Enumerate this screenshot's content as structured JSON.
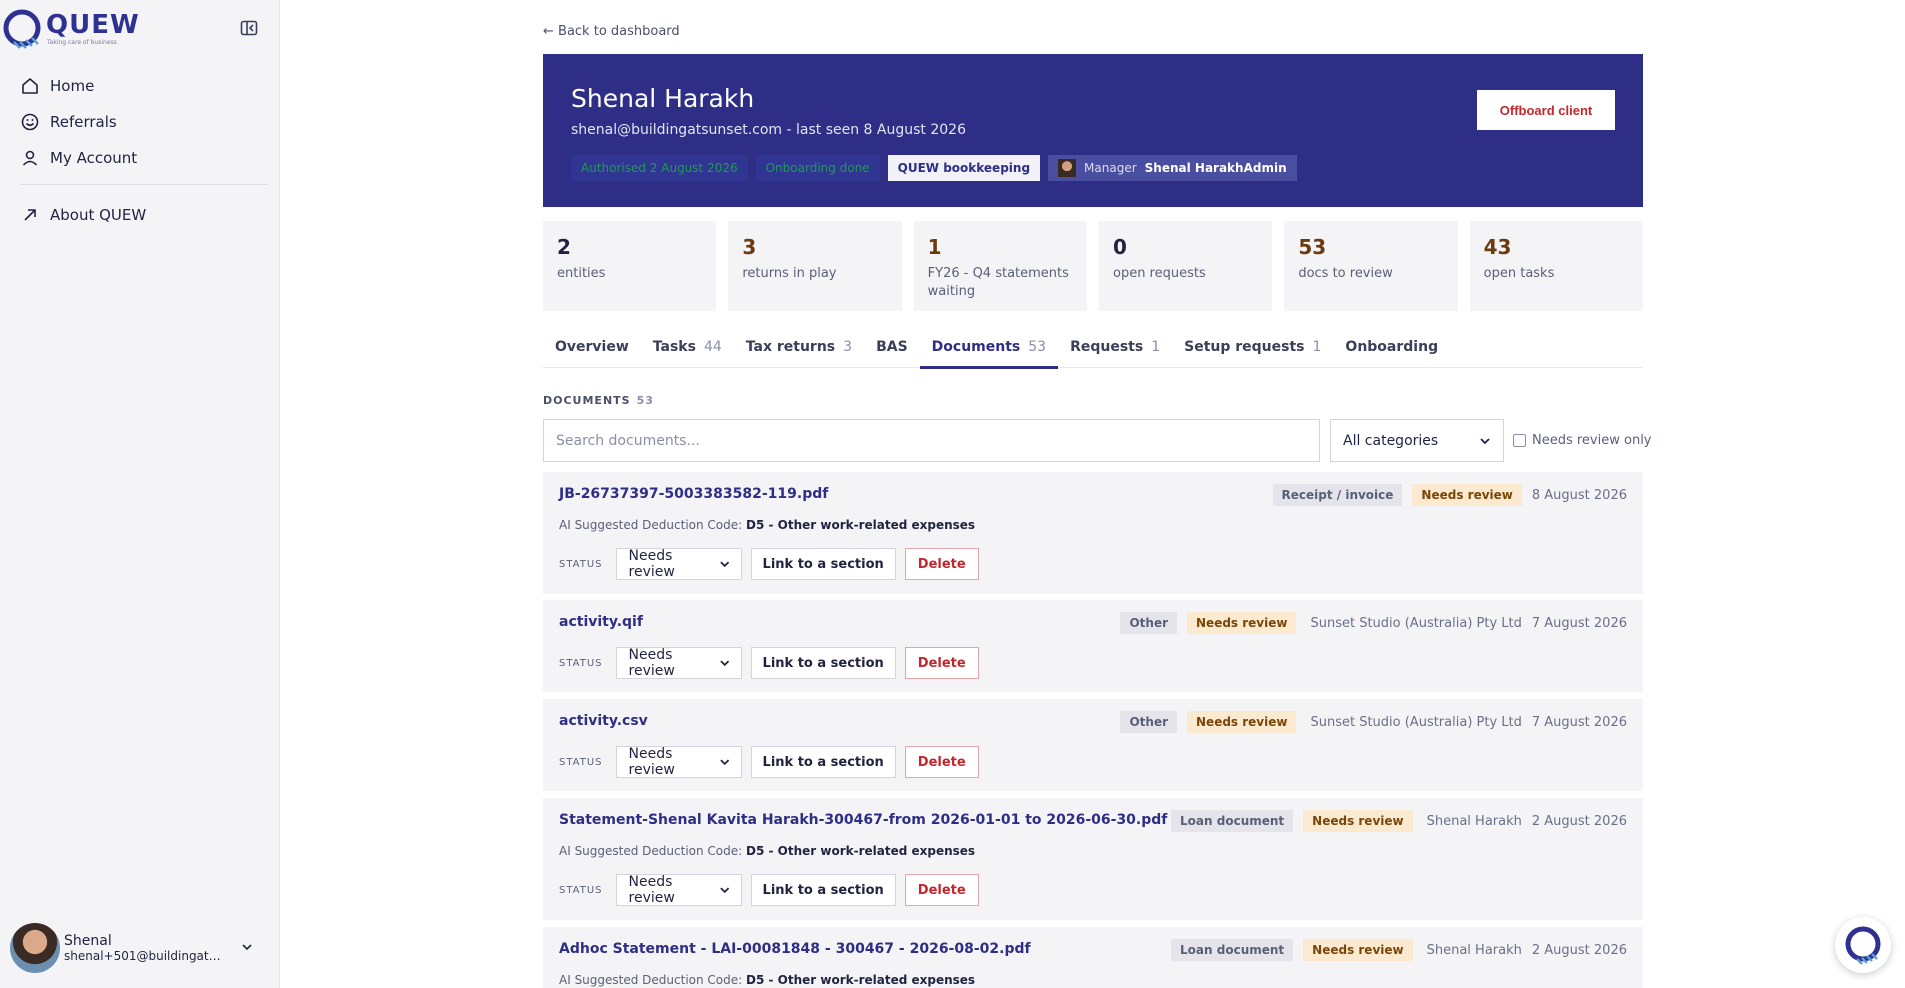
{
  "brand": {
    "name": "QUEW",
    "tagline": "Taking care of business"
  },
  "sidebar": {
    "items": [
      {
        "label": "Home",
        "icon": "home-icon"
      },
      {
        "label": "Referrals",
        "icon": "smile-icon"
      },
      {
        "label": "My Account",
        "icon": "user-icon"
      }
    ],
    "about_label": "About QUEW",
    "user": {
      "name": "Shenal",
      "email": "shenal+501@buildingats..."
    }
  },
  "back_link": "← Back to dashboard",
  "client": {
    "name": "Shenal Harakh",
    "subline": "shenal@buildingatsunset.com - last seen 8 August 2026",
    "badges": {
      "authorised": "Authorised 2 August 2026",
      "onboarding": "Onboarding done",
      "service": "QUEW bookkeeping",
      "manager_label": "Manager",
      "manager_name": "Shenal HarakhAdmin"
    },
    "offboard_label": "Offboard client"
  },
  "stats": [
    {
      "value": "2",
      "label": "entities"
    },
    {
      "value": "3",
      "label": "returns in play"
    },
    {
      "value": "1",
      "label": "FY26 - Q4 statements waiting"
    },
    {
      "value": "0",
      "label": "open requests"
    },
    {
      "value": "53",
      "label": "docs to review"
    },
    {
      "value": "43",
      "label": "open tasks"
    }
  ],
  "tabs": [
    {
      "label": "Overview",
      "count": ""
    },
    {
      "label": "Tasks",
      "count": "44"
    },
    {
      "label": "Tax returns",
      "count": "3"
    },
    {
      "label": "BAS",
      "count": ""
    },
    {
      "label": "Documents",
      "count": "53"
    },
    {
      "label": "Requests",
      "count": "1"
    },
    {
      "label": "Setup requests",
      "count": "1"
    },
    {
      "label": "Onboarding",
      "count": ""
    }
  ],
  "documents": {
    "section_title": "DOCUMENTS",
    "section_count": "53",
    "search_placeholder": "Search documents...",
    "category_selected": "All categories",
    "needs_review_only_label": "Needs review only",
    "status_label": "STATUS",
    "link_label": "Link to a section",
    "delete_label": "Delete",
    "ai_label": "AI Suggested Deduction Code:",
    "items": [
      {
        "name": "JB-26737397-5003383582-119.pdf",
        "category": "Receipt / invoice",
        "review": "Needs review",
        "entity": "",
        "date": "8 August 2026",
        "ai_code": "D5 - Other work-related expenses",
        "status": "Needs review"
      },
      {
        "name": "activity.qif",
        "category": "Other",
        "review": "Needs review",
        "entity": "Sunset Studio (Australia) Pty Ltd",
        "date": "7 August 2026",
        "ai_code": "",
        "status": "Needs review"
      },
      {
        "name": "activity.csv",
        "category": "Other",
        "review": "Needs review",
        "entity": "Sunset Studio (Australia) Pty Ltd",
        "date": "7 August 2026",
        "ai_code": "",
        "status": "Needs review"
      },
      {
        "name": "Statement-Shenal Kavita Harakh-300467-from 2026-01-01 to 2026-06-30.pdf",
        "category": "Loan document",
        "review": "Needs review",
        "entity": "Shenal Harakh",
        "date": "2 August 2026",
        "ai_code": "D5 - Other work-related expenses",
        "status": "Needs review"
      },
      {
        "name": "Adhoc Statement - LAI-00081848 - 300467 - 2026-08-02.pdf",
        "category": "Loan document",
        "review": "Needs review",
        "entity": "Shenal Harakh",
        "date": "2 August 2026",
        "ai_code": "D5 - Other work-related expenses",
        "status": ""
      }
    ]
  },
  "colors": {
    "brand": "#2e2e86",
    "danger": "#c0282d",
    "review_bg": "#fbe9d0",
    "success": "#1f9a53"
  }
}
